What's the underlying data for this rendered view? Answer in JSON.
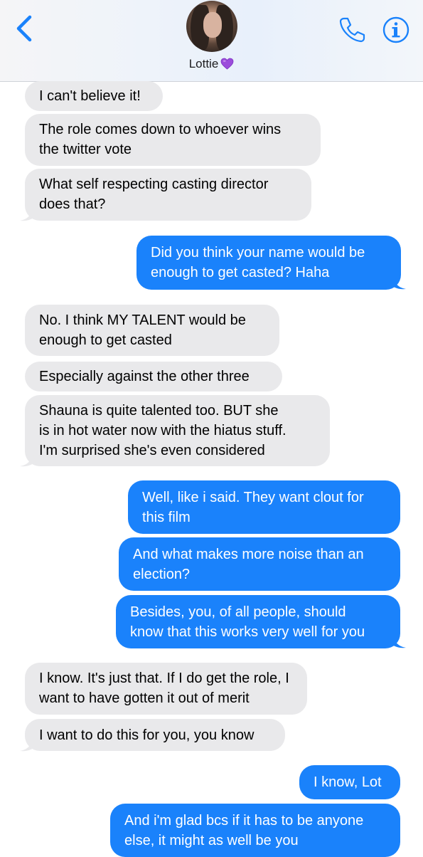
{
  "header": {
    "contact_name": "Lottie",
    "contact_emoji": "purple-heart-icon",
    "accent_color": "#1a82fb"
  },
  "messages": [
    {
      "from": "contact",
      "text": "I can't believe it!"
    },
    {
      "from": "contact",
      "lines": [
        "The role comes down to whoever wins",
        "the twitter vote"
      ]
    },
    {
      "from": "contact",
      "lines": [
        "What self respecting casting director",
        "does that?"
      ]
    },
    {
      "from": "me",
      "lines": [
        "Did you think your name would be",
        "enough to get casted? Haha"
      ]
    },
    {
      "from": "contact",
      "lines": [
        "No. I think MY TALENT would be",
        "enough to get casted"
      ]
    },
    {
      "from": "contact",
      "text": "Especially against the other three"
    },
    {
      "from": "contact",
      "lines": [
        "Shauna is quite talented too. BUT she",
        "is in hot water now with the hiatus stuff.",
        "I'm surprised she's even considered"
      ]
    },
    {
      "from": "me",
      "lines": [
        "Well, like i said. They want clout for",
        "this film"
      ]
    },
    {
      "from": "me",
      "lines": [
        "And what makes more noise than an",
        "election?"
      ]
    },
    {
      "from": "me",
      "lines": [
        "Besides, you, of all people, should",
        "know that this works very well for you"
      ]
    },
    {
      "from": "contact",
      "lines": [
        "I know. It's just that. If I do get the role, I",
        "want to have gotten it out of merit"
      ]
    },
    {
      "from": "contact",
      "text": "I want to do this for you, you know"
    },
    {
      "from": "me",
      "text": "I know, Lot"
    },
    {
      "from": "me",
      "lines": [
        "And i'm glad bcs if it has to be anyone",
        "else, it might as well be you"
      ]
    }
  ]
}
